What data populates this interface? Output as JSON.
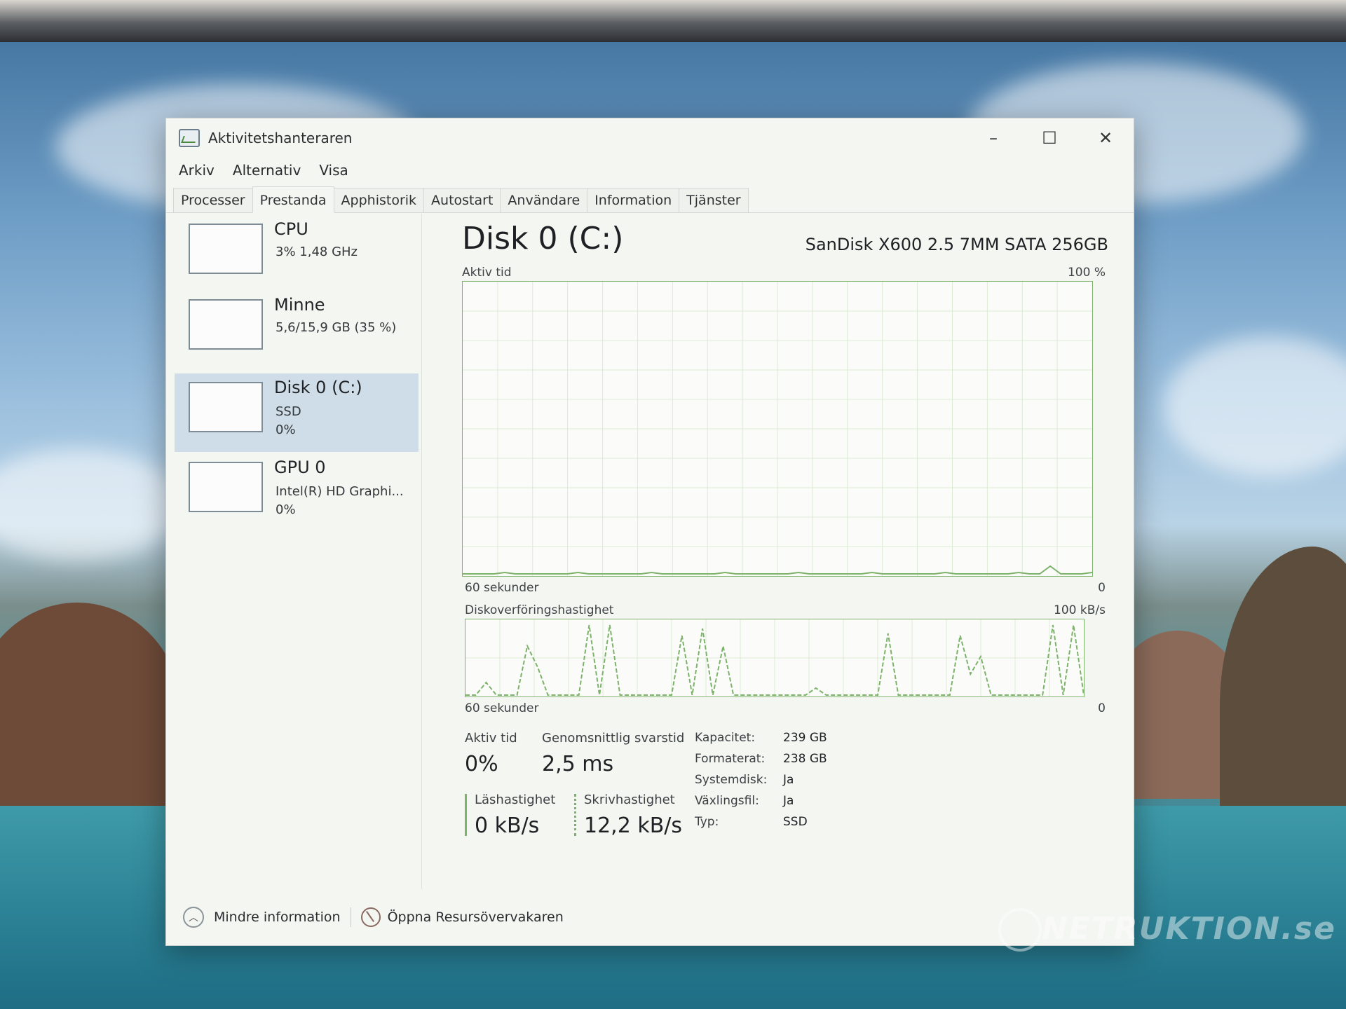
{
  "window": {
    "title": "Aktivitetshanteraren",
    "controls": {
      "minimize": "–",
      "maximize": "☐",
      "close": "✕"
    }
  },
  "menu": [
    "Arkiv",
    "Alternativ",
    "Visa"
  ],
  "tabs": [
    "Processer",
    "Prestanda",
    "Apphistorik",
    "Autostart",
    "Användare",
    "Information",
    "Tjänster"
  ],
  "active_tab": "Prestanda",
  "sidebar": {
    "items": [
      {
        "title": "CPU",
        "line1": "3% 1,48 GHz",
        "line2": ""
      },
      {
        "title": "Minne",
        "line1": "5,6/15,9 GB (35 %)",
        "line2": ""
      },
      {
        "title": "Disk 0 (C:)",
        "line1": "SSD",
        "line2": "0%"
      },
      {
        "title": "GPU 0",
        "line1": "Intel(R) HD Graphi...",
        "line2": "0%"
      }
    ],
    "selected_index": 2
  },
  "main": {
    "title": "Disk 0 (C:)",
    "model": "SanDisk X600 2.5 7MM SATA 256GB",
    "graph1": {
      "label": "Aktiv tid",
      "max_label": "100 %",
      "left_label": "60 sekunder",
      "right_label": "0"
    },
    "graph2": {
      "label": "Diskoverföringshastighet",
      "max_label": "100 kB/s",
      "left_label": "60 sekunder",
      "right_label": "0"
    },
    "stats": {
      "active_time": {
        "label": "Aktiv tid",
        "value": "0%"
      },
      "avg_response": {
        "label": "Genomsnittlig svarstid",
        "value": "2,5 ms"
      },
      "read_speed": {
        "label": "Läshastighet",
        "value": "0 kB/s"
      },
      "write_speed": {
        "label": "Skrivhastighet",
        "value": "12,2 kB/s"
      }
    },
    "properties": [
      {
        "key": "Kapacitet:",
        "value": "239 GB"
      },
      {
        "key": "Formaterat:",
        "value": "238 GB"
      },
      {
        "key": "Systemdisk:",
        "value": "Ja"
      },
      {
        "key": "Växlingsfil:",
        "value": "Ja"
      },
      {
        "key": "Typ:",
        "value": "SSD"
      }
    ]
  },
  "footer": {
    "less_info": "Mindre information",
    "open_resmon": "Öppna Resursövervakaren"
  },
  "watermark": "NETRUKTION.se",
  "colors": {
    "graph_line": "#7db26a",
    "selected_bg": "#cfdde8",
    "window_bg": "#f4f6f1"
  }
}
